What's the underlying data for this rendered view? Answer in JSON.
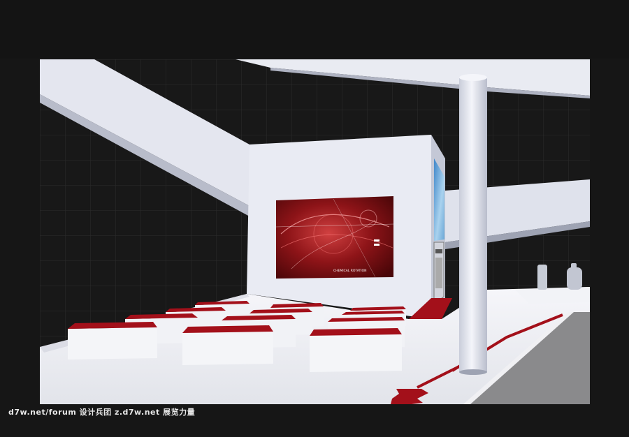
{
  "caption": "d7w.net/forum 设计兵团 z.d7w.net 展览力量",
  "screen_text": "CHEMICAL ROTATION",
  "colors": {
    "accent_red": "#a3101a",
    "wall_white": "#e9ebf2",
    "background_grid": "#222"
  }
}
